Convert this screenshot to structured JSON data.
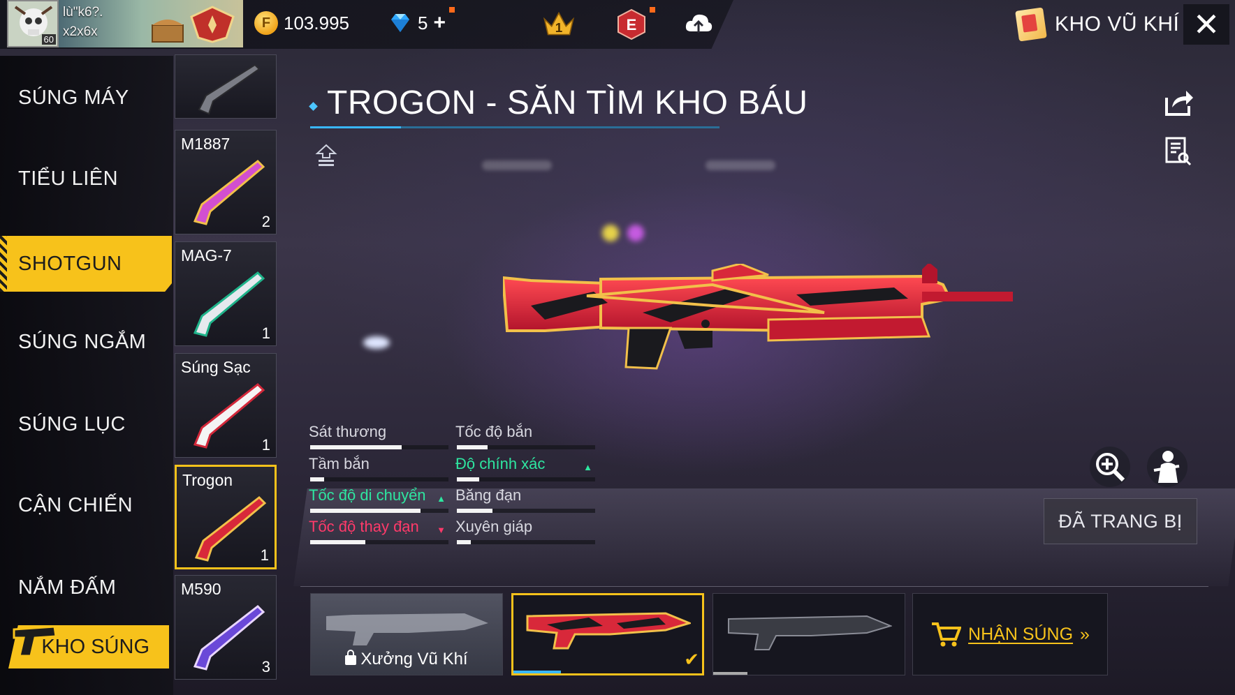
{
  "player": {
    "level": "60",
    "name_lines": "lù\"k6?.\nx2x6x"
  },
  "currency": {
    "gold": "103.995",
    "diamonds": "5",
    "diamond_plus": "+"
  },
  "header": {
    "badge_rank": "1",
    "badge_e": "E",
    "title": "KHO VŨ KHÍ"
  },
  "categories": [
    {
      "label": "SÚNG MÁY",
      "active": false
    },
    {
      "label": "TIỂU LIÊN",
      "active": false
    },
    {
      "label": "SHOTGUN",
      "active": true
    },
    {
      "label": "SÚNG NGẮM",
      "active": false
    },
    {
      "label": "SÚNG LỤC",
      "active": false
    },
    {
      "label": "CẬN CHIẾN",
      "active": false
    },
    {
      "label": "NẮM ĐẤM",
      "active": false
    }
  ],
  "armory_button": "KHO SÚNG",
  "weapons": [
    {
      "name": "",
      "count": ""
    },
    {
      "name": "M1887",
      "count": "2"
    },
    {
      "name": "MAG-7",
      "count": "1"
    },
    {
      "name": "Súng Sạc",
      "count": "1"
    },
    {
      "name": "Trogon",
      "count": "1",
      "selected": true
    },
    {
      "name": "M590",
      "count": "3"
    }
  ],
  "selected_weapon": {
    "title": "TROGON - SĂN TÌM KHO BÁU"
  },
  "stats": [
    {
      "label": "Sát thương",
      "value": 0.66,
      "trend": "none"
    },
    {
      "label": "Tốc độ bắn",
      "value": 0.22,
      "trend": "none"
    },
    {
      "label": "Tầm bắn",
      "value": 0.1,
      "trend": "none"
    },
    {
      "label": "Độ chính xác",
      "value": 0.16,
      "trend": "up"
    },
    {
      "label": "Tốc độ di chuyển",
      "value": 0.8,
      "trend": "up"
    },
    {
      "label": "Băng đạn",
      "value": 0.26,
      "trend": "none"
    },
    {
      "label": "Tốc độ thay đạn",
      "value": 0.4,
      "trend": "down"
    },
    {
      "label": "Xuyên giáp",
      "value": 0.1,
      "trend": "none"
    }
  ],
  "actions": {
    "equipped": "ĐÃ TRANG BỊ",
    "workshop": "Xưởng Vũ Khí",
    "get_gun": "NHẬN SÚNG",
    "get_gun_arrow": "»"
  },
  "colors": {
    "accent": "#f7c21b",
    "stat_up": "#2ee6a0",
    "stat_down": "#ff3a6a",
    "title_underline": "#39b7ff"
  }
}
